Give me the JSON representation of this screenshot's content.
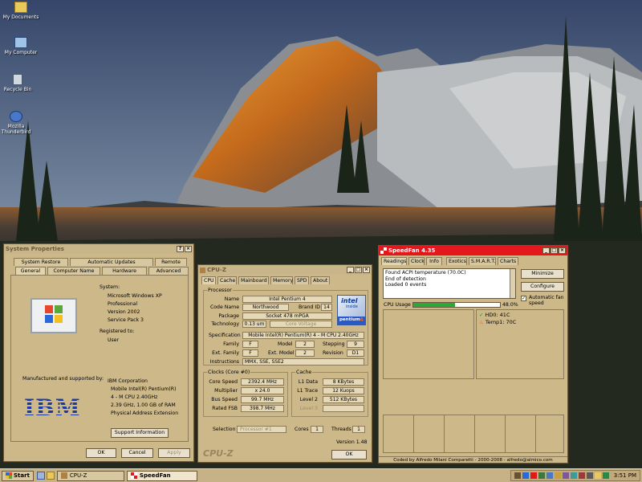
{
  "desktop": {
    "icons": [
      {
        "label": "My Documents"
      },
      {
        "label": "My Computer"
      },
      {
        "label": "Recycle Bin"
      },
      {
        "label": "Mozilla Thunderbird"
      }
    ]
  },
  "sysprops": {
    "title": "System Properties",
    "tabs_row1": [
      "System Restore",
      "Automatic Updates",
      "Remote"
    ],
    "tabs_row2": [
      "General",
      "Computer Name",
      "Hardware",
      "Advanced"
    ],
    "system_label": "System:",
    "system_lines": [
      "Microsoft Windows XP",
      "Professional",
      "Version 2002",
      "Service Pack 3"
    ],
    "registered_label": "Registered to:",
    "registered_user": "User",
    "manufactured_label": "Manufactured and supported by:",
    "manufacturer_lines": [
      "IBM Corporation",
      "Mobile Intel(R) Pentium(R)",
      "4 - M CPU 2.40GHz",
      "2.39 GHz, 1.00 GB of RAM",
      "Physical Address Extension"
    ],
    "logo_text": "IBM",
    "support_button": "Support Information",
    "ok": "OK",
    "cancel": "Cancel",
    "apply": "Apply"
  },
  "cpuz": {
    "title": "CPU-Z",
    "tabs": [
      "CPU",
      "Cache",
      "Mainboard",
      "Memory",
      "SPD",
      "About"
    ],
    "processor_group": "Processor",
    "name_label": "Name",
    "name": "Intel Pentium 4",
    "codename_label": "Code Name",
    "codename": "Northwood",
    "brandid_label": "Brand ID",
    "brandid": "14",
    "package_label": "Package",
    "package": "Socket 478 mPGA",
    "technology_label": "Technology",
    "technology": "0.13 um",
    "core_voltage_label": "Core Voltage",
    "spec_label": "Specification",
    "spec": "Mobile Intel(R) Pentium(R) 4 - M CPU 2.40GHz",
    "family_label": "Family",
    "family": "F",
    "model_label": "Model",
    "model": "2",
    "stepping_label": "Stepping",
    "stepping": "9",
    "extfamily_label": "Ext. Family",
    "extfamily": "F",
    "extmodel_label": "Ext. Model",
    "extmodel": "2",
    "revision_label": "Revision",
    "revision": "D1",
    "instructions_label": "Instructions",
    "instructions": "MMX, SSE, SSE2",
    "intel_logo": {
      "top": "intel",
      "mid": "inside",
      "bottom": "pentium",
      "num": "4"
    },
    "clocks_group": "Clocks (Core #0)",
    "corespeed_label": "Core Speed",
    "corespeed": "2392.4 MHz",
    "multiplier_label": "Multiplier",
    "multiplier": "x 24.0",
    "busspeed_label": "Bus Speed",
    "busspeed": "99.7 MHz",
    "ratedfsb_label": "Rated FSB",
    "ratedfsb": "398.7 MHz",
    "cache_group": "Cache",
    "l1data_label": "L1 Data",
    "l1data": "8 KBytes",
    "l1trace_label": "L1 Trace",
    "l1trace": "12 Kuops",
    "level2_label": "Level 2",
    "level2": "512 KBytes",
    "level3_label": "Level 3",
    "selection_label": "Selection",
    "selection": "Processor #1",
    "cores_label": "Cores",
    "cores": "1",
    "threads_label": "Threads",
    "threads": "1",
    "version": "Version 1.48",
    "brand": "CPU-Z",
    "ok": "OK"
  },
  "speedfan": {
    "title": "SpeedFan 4.35",
    "tabs": [
      "Readings",
      "Clock",
      "Info",
      "Exotics",
      "S.M.A.R.T.",
      "Charts"
    ],
    "log_lines": [
      "Found ACPI temperature (70.0C)",
      "End of detection",
      "Loaded 0 events"
    ],
    "minimize": "Minimize",
    "configure": "Configure",
    "auto_fan": "Automatic fan speed",
    "cpu_usage_label": "CPU Usage",
    "cpu_usage_value": "48.0%",
    "cpu_usage_fraction": 0.48,
    "temps": [
      {
        "label": "HD0:",
        "value": "41C"
      },
      {
        "label": "Temp1:",
        "value": "70C"
      }
    ],
    "footer": "Coded by Alfredo Milani Comparetti - 2000-2008 - alfredo@almico.com"
  },
  "taskbar": {
    "start": "Start",
    "tasks": [
      {
        "label": "CPU-Z"
      },
      {
        "label": "SpeedFan"
      }
    ],
    "clock": "3:51 PM"
  }
}
